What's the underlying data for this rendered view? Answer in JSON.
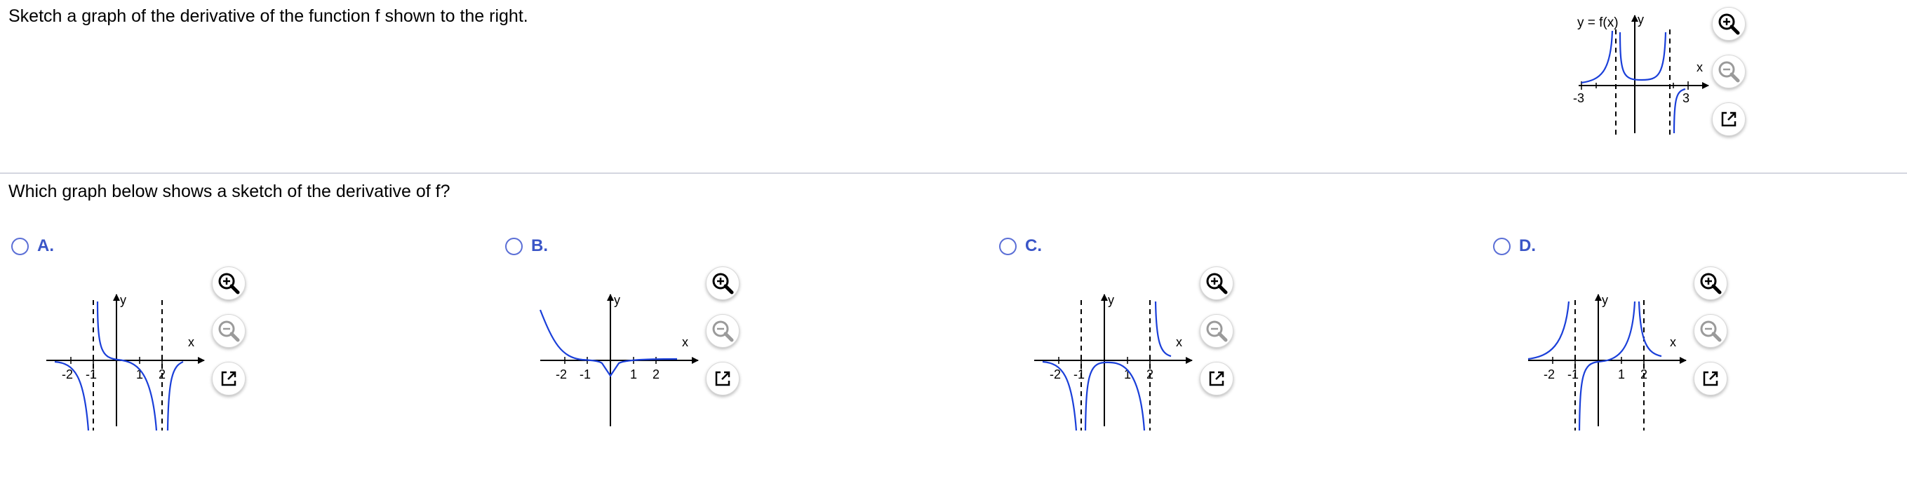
{
  "question": {
    "prompt": "Sketch a graph of the derivative of the function f shown to the right.",
    "sub_prompt": "Which graph below shows a sketch of the derivative of f?"
  },
  "main_graph": {
    "label": "y = f(x)",
    "x_axis": "x",
    "y_axis": "y",
    "ticks": [
      "-3",
      "3"
    ]
  },
  "choices": [
    {
      "letter": "A.",
      "x_axis": "x",
      "y_axis": "y",
      "ticks": [
        "-2",
        "-1",
        "1",
        "2"
      ]
    },
    {
      "letter": "B.",
      "x_axis": "x",
      "y_axis": "y",
      "ticks": [
        "-2",
        "-1",
        "1",
        "2"
      ]
    },
    {
      "letter": "C.",
      "x_axis": "x",
      "y_axis": "y",
      "ticks": [
        "-2",
        "-1",
        "1",
        "2"
      ]
    },
    {
      "letter": "D.",
      "x_axis": "x",
      "y_axis": "y",
      "ticks": [
        "-2",
        "-1",
        "1",
        "2"
      ]
    }
  ],
  "icons": {
    "zoom_in": "zoom-in-icon",
    "zoom_out": "zoom-out-icon",
    "popout": "popout-icon"
  },
  "colors": {
    "curve": "#1a3fd9",
    "choice_letter": "#3a55c7",
    "radio_border": "#5b6fd6",
    "divider": "#d4d6e0",
    "zoom_out_disabled": "#9a9a9a"
  }
}
